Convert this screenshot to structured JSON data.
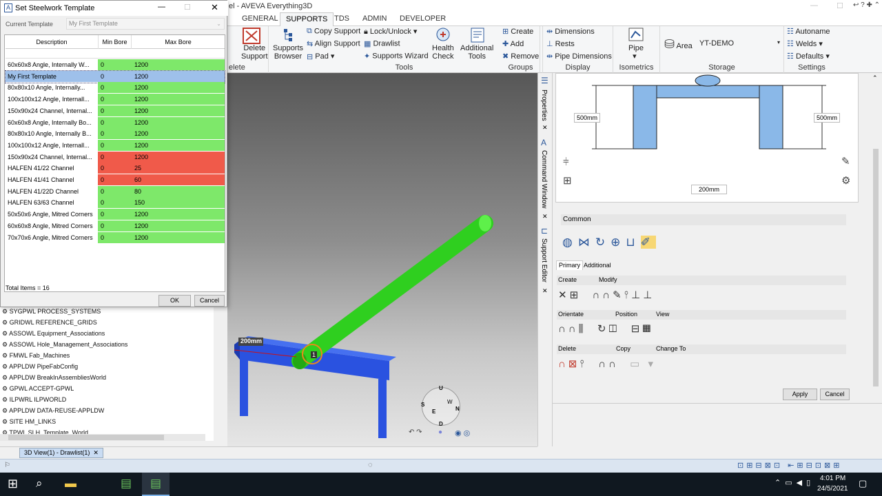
{
  "app": {
    "title_fragment": "el - AVEVA Everything3D"
  },
  "ribbon": {
    "tabs": [
      "GENERAL",
      "SUPPORTS",
      "TDS",
      "ADMIN",
      "DEVELOPER"
    ],
    "active_tab": "SUPPORTS",
    "delete_support": "Delete\nSupport",
    "delete_group_label": "elete",
    "supports_browser": "Supports\nBrowser",
    "copy_support": "Copy Support",
    "align_support": "Align Support",
    "pad": "Pad",
    "lock_unlock": "Lock/Unlock",
    "drawlist": "Drawlist",
    "supports_wizard": "Supports Wizard",
    "health_check": "Health\nCheck",
    "additional_tools": "Additional\nTools",
    "tools_label": "Tools",
    "create": "Create",
    "add": "Add",
    "remove": "Remove",
    "groups_label": "Groups",
    "dimensions": "Dimensions",
    "rests": "Rests",
    "pipe_dimensions": "Pipe Dimensions",
    "display_label": "Display",
    "pipe": "Pipe",
    "isometrics_label": "Isometrics",
    "area": "Area",
    "area_value": "YT-DEMO",
    "storage_label": "Storage",
    "autoname": "Autoname",
    "welds": "Welds",
    "defaults": "Defaults",
    "settings_label": "Settings"
  },
  "dialog": {
    "title": "Set Steelwork Template",
    "current_template_label": "Current Template",
    "current_template_value": "My First Template",
    "columns": [
      "Description",
      "Min Bore",
      "Max Bore"
    ],
    "rows": [
      {
        "desc": "60x60x8  Angle,  Internally  W...",
        "min": "0",
        "max": "1200",
        "status": "ok"
      },
      {
        "desc": "My First Template",
        "min": "0",
        "max": "1200",
        "status": "selected"
      },
      {
        "desc": "80x80x10  Angle,  Internally...",
        "min": "0",
        "max": "1200",
        "status": "ok"
      },
      {
        "desc": "100x100x12  Angle,  Internall...",
        "min": "0",
        "max": "1200",
        "status": "ok"
      },
      {
        "desc": "150x90x24  Channel,  Internal...",
        "min": "0",
        "max": "1200",
        "status": "ok"
      },
      {
        "desc": "60x60x8  Angle,  Internally  Bo...",
        "min": "0",
        "max": "1200",
        "status": "ok"
      },
      {
        "desc": "80x80x10  Angle,  Internally  B...",
        "min": "0",
        "max": "1200",
        "status": "ok"
      },
      {
        "desc": "100x100x12  Angle,  Internall...",
        "min": "0",
        "max": "1200",
        "status": "ok"
      },
      {
        "desc": "150x90x24  Channel,  Internal...",
        "min": "0",
        "max": "1200",
        "status": "bad"
      },
      {
        "desc": "HALFEN 41/22 Channel",
        "min": "0",
        "max": "25",
        "status": "bad"
      },
      {
        "desc": "HALFEN 41/41 Channel",
        "min": "0",
        "max": "60",
        "status": "bad"
      },
      {
        "desc": "HALFEN 41/22D Channel",
        "min": "0",
        "max": "80",
        "status": "ok"
      },
      {
        "desc": "HALFEN 63/63 Channel",
        "min": "0",
        "max": "150",
        "status": "ok"
      },
      {
        "desc": "50x50x6 Angle, Mitred Corners",
        "min": "0",
        "max": "1200",
        "status": "ok"
      },
      {
        "desc": "60x60x8 Angle, Mitred Corners",
        "min": "0",
        "max": "1200",
        "status": "ok"
      },
      {
        "desc": "70x70x6 Angle, Mitred Corners",
        "min": "0",
        "max": "1200",
        "status": "ok"
      }
    ],
    "total": "Total Items = 16",
    "ok": "OK",
    "cancel": "Cancel"
  },
  "explorer": {
    "items": [
      "SYGPWL PROCESS_SYSTEMS",
      "GRIDWL REFERENCE_GRIDS",
      "ASSOWL Equipment_Associations",
      "ASSOWL Hole_Management_Associations",
      "FMWL Fab_Machines",
      "APPLDW PipeFabConfig",
      "APPLDW BreakInAssembliesWorld",
      "GPWL ACCEPT-GPWL",
      "ILPWRL ILPWORLD",
      "APPLDW DATA-REUSE-APPLDW",
      "SITE HM_LINKS",
      "TPWL SLH_Template_World"
    ],
    "tab": "3D View(1) - Drawlist(1)"
  },
  "viewport": {
    "dim_label": "200mm",
    "marker": "1",
    "nav": [
      "U",
      "S",
      "E",
      "N",
      "D",
      "W"
    ]
  },
  "side_strip": {
    "properties": "Properties",
    "command_window": "Command Window",
    "support_editor": "Support Editor"
  },
  "editor": {
    "dim_left": "500mm",
    "dim_right": "500mm",
    "dim_bottom": "200mm",
    "common": "Common",
    "tabs": [
      "Primary",
      "Additional"
    ],
    "create": "Create",
    "modify": "Modify",
    "orientate": "Orientate",
    "position": "Position",
    "view": "View",
    "delete": "Delete",
    "copy": "Copy",
    "change_to": "Change To",
    "apply": "Apply",
    "cancel": "Cancel"
  },
  "taskbar": {
    "time": "4:01 PM",
    "date": "24/5/2021"
  },
  "colors": {
    "ok": "#7ee86a",
    "bad": "#f05a4a",
    "selected": "#9ec0ea",
    "pipe": "#2fcf1f",
    "steel": "#2a52e0",
    "accent": "#2b579a"
  }
}
